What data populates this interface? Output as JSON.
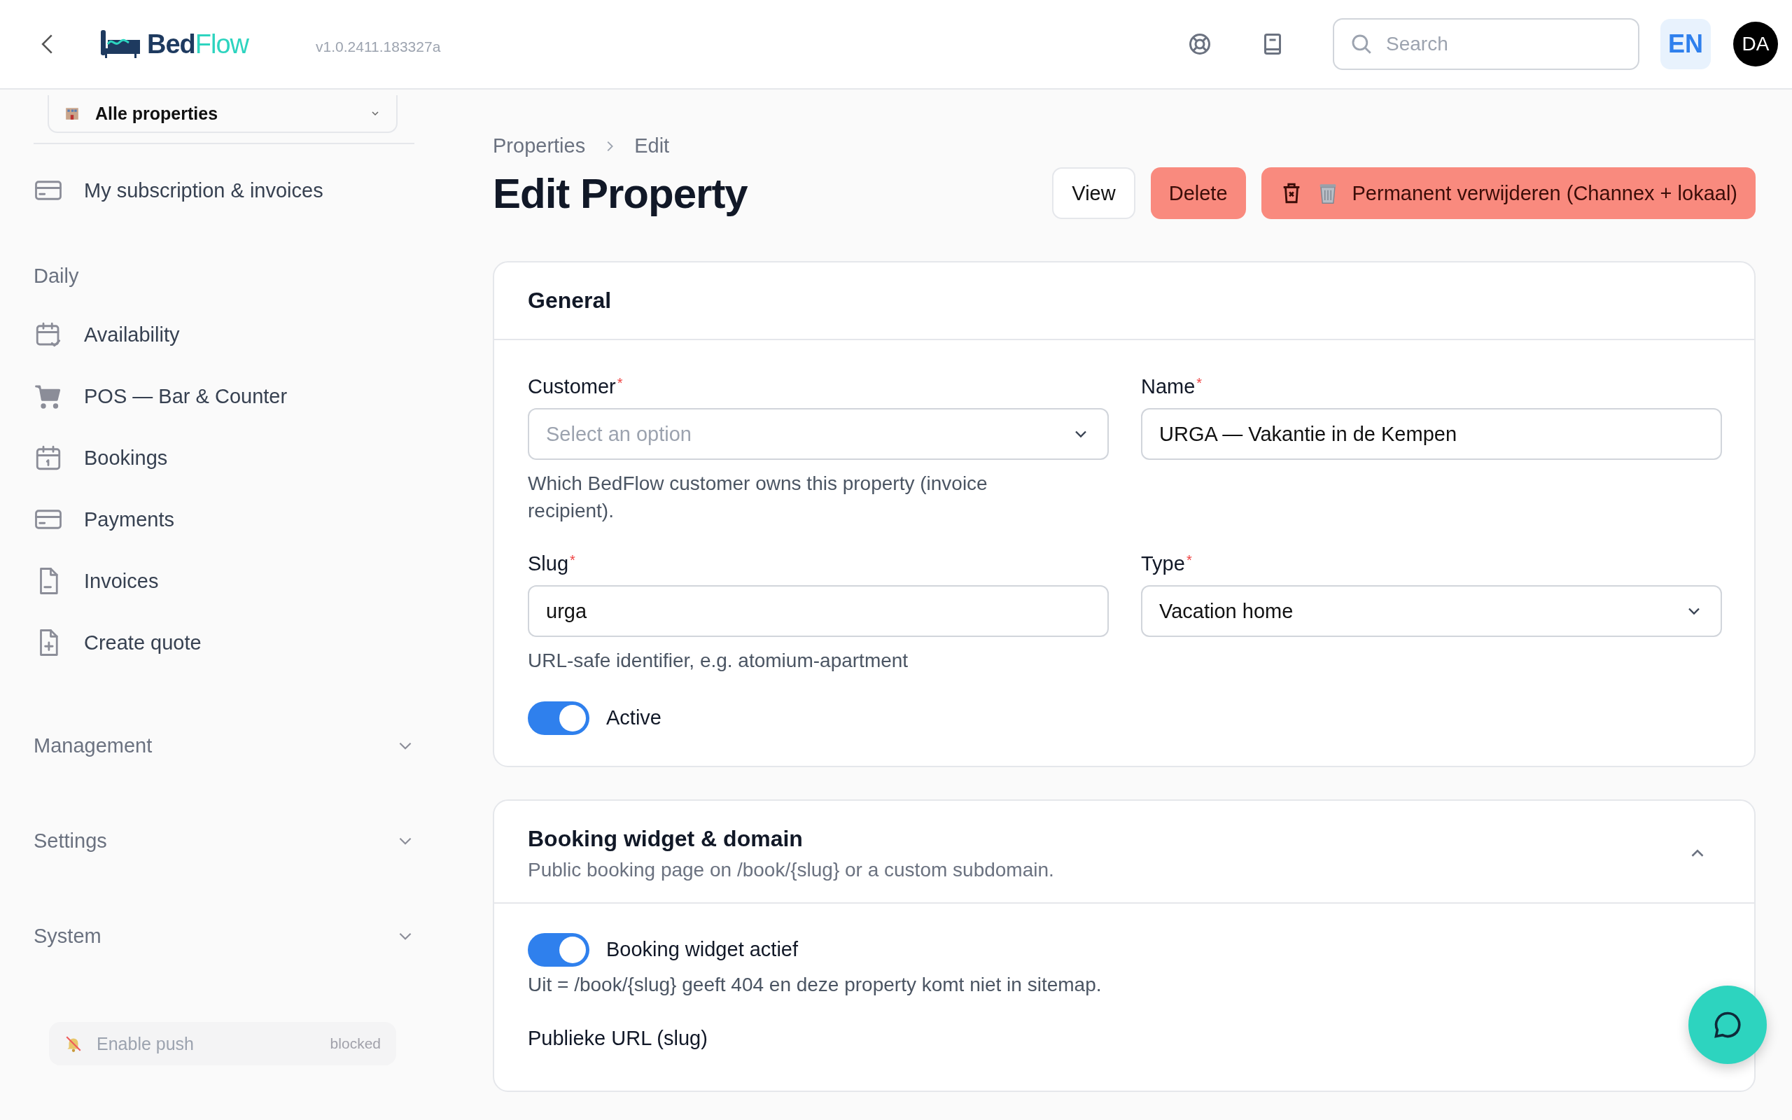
{
  "header": {
    "brand_dark": "Bed",
    "brand_light": "Flow",
    "version": "v1.0.2411.183327a",
    "search": {
      "placeholder": "Search"
    },
    "language": "EN",
    "avatar": "DA"
  },
  "sidebar": {
    "property_select": "Alle properties",
    "top_items": [
      {
        "label": "My subscription & invoices",
        "kind": "card"
      }
    ],
    "sections": [
      {
        "title": "Daily",
        "items": [
          {
            "label": "Availability",
            "kind": "availability"
          },
          {
            "label": "POS — Bar & Counter",
            "kind": "cart"
          },
          {
            "label": "Bookings",
            "kind": "calendar"
          },
          {
            "label": "Payments",
            "kind": "card"
          },
          {
            "label": "Invoices",
            "kind": "document"
          },
          {
            "label": "Create quote",
            "kind": "quote"
          }
        ]
      },
      {
        "title": "Management",
        "expanded": false
      },
      {
        "title": "Settings",
        "expanded": false
      },
      {
        "title": "System",
        "expanded": false
      }
    ],
    "push": {
      "label": "Enable push",
      "status": "blocked"
    }
  },
  "main": {
    "breadcrumbs": [
      "Properties",
      "Edit"
    ],
    "title": "Edit Property",
    "actions": [
      {
        "label": "View",
        "kind": "secondary"
      },
      {
        "label": "Delete",
        "kind": "danger"
      },
      {
        "label": "Permanent verwijderen (Channex + lokaal)",
        "kind": "danger-icon"
      }
    ],
    "general": {
      "title": "General",
      "fields": [
        {
          "label": "Customer",
          "required_mark": "*",
          "kind": "select",
          "placeholder": "Select an option",
          "help": "Which BedFlow customer owns this property (invoice recipient)."
        },
        {
          "label": "Name",
          "required_mark": "*",
          "kind": "text",
          "value": "URGA — Vakantie in de Kempen"
        },
        {
          "label": "Slug",
          "required_mark": "*",
          "kind": "text",
          "value": "urga",
          "help": "URL-safe identifier, e.g. atomium-apartment"
        },
        {
          "label": "Type",
          "required_mark": "*",
          "kind": "select",
          "value": "Vacation home"
        }
      ],
      "toggle": {
        "label": "Active",
        "on": true
      }
    },
    "widget": {
      "title": "Booking widget & domain",
      "subtitle": "Public booking page on /book/{slug} or a custom subdomain.",
      "expanded": true,
      "toggle": {
        "label": "Booking widget actief",
        "on": true
      },
      "help": "Uit = /book/{slug} geeft 404 en deze property komt niet in sitemap.",
      "field_label": "Publieke URL (slug)"
    }
  }
}
